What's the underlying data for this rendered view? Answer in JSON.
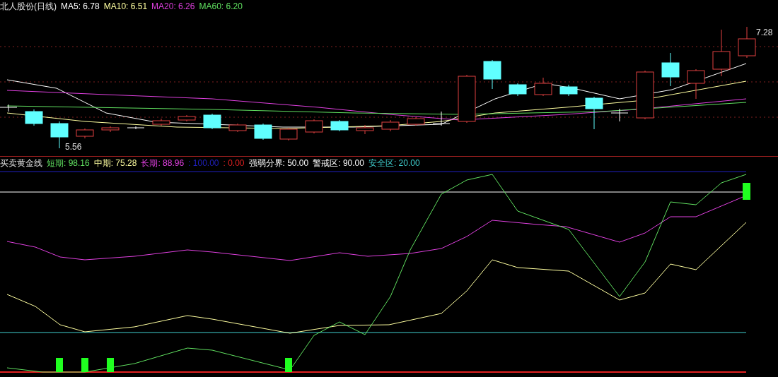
{
  "main_panel": {
    "title": "北人股份(日线)",
    "legend": [
      {
        "text": "MA5: 6.78",
        "color": "#ffffff"
      },
      {
        "text": "MA10: 6.51",
        "color": "#ffffa0"
      },
      {
        "text": "MA20: 6.26",
        "color": "#e040e0"
      },
      {
        "text": "MA60: 6.20",
        "color": "#60e060"
      }
    ],
    "high_marker": "7.28",
    "low_marker": "5.56"
  },
  "indicator_panel": {
    "title": "买卖黄金线",
    "legend": [
      {
        "text": "短期: 98.16",
        "color": "#60e060"
      },
      {
        "text": "中期: 75.28",
        "color": "#ffffa0"
      },
      {
        "text": "长期: 88.96",
        "color": "#e040e0"
      },
      {
        "text": ": 100.00",
        "color": "#2020c0"
      },
      {
        "text": ": 0.00",
        "color": "#e02020"
      },
      {
        "text": "强弱分界: 50.00",
        "color": "#ffffff"
      },
      {
        "text": "警戒区: 90.00",
        "color": "#ffffff"
      },
      {
        "text": "安全区: 20.00",
        "color": "#40d0d0"
      }
    ]
  }
}
